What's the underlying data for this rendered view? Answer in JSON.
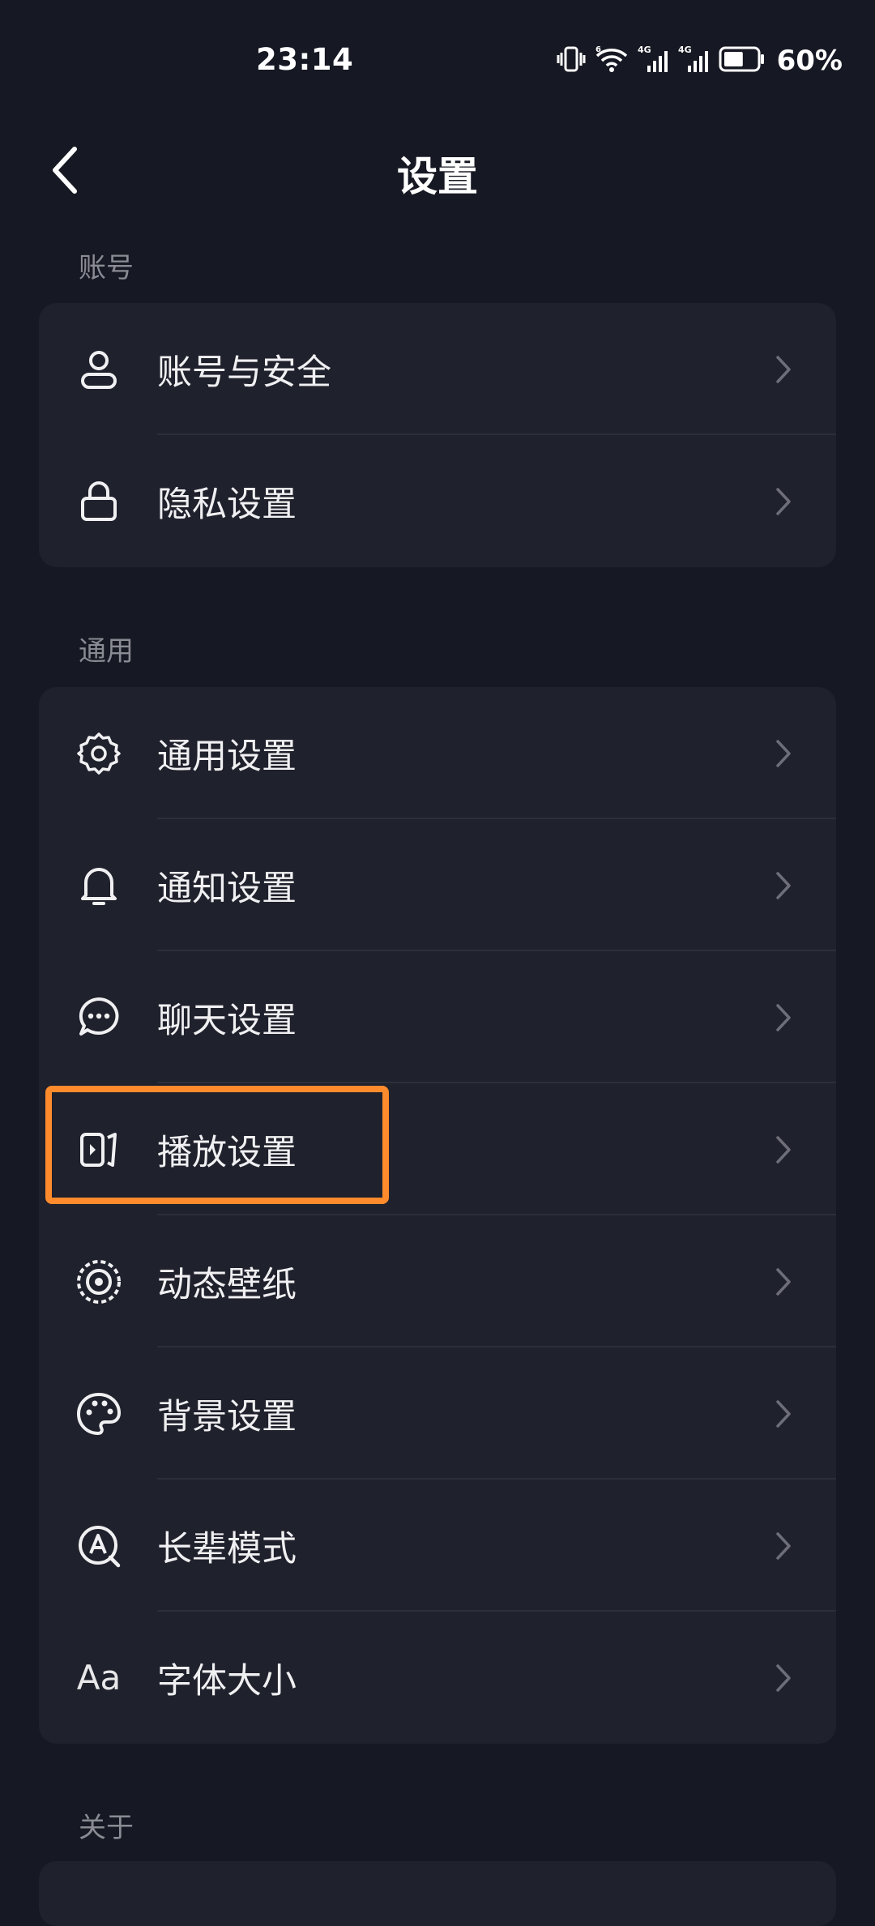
{
  "status_bar": {
    "time": "23:14",
    "battery_percent": "60%",
    "battery_level": 0.6,
    "network_labels": [
      "4G",
      "4G"
    ],
    "wifi_label": "6"
  },
  "header": {
    "title": "设置"
  },
  "sections": [
    {
      "label": "账号",
      "items": [
        {
          "label": "账号与安全",
          "icon": "user-icon"
        },
        {
          "label": "隐私设置",
          "icon": "lock-icon"
        }
      ]
    },
    {
      "label": "通用",
      "items": [
        {
          "label": "通用设置",
          "icon": "gear-icon"
        },
        {
          "label": "通知设置",
          "icon": "bell-icon"
        },
        {
          "label": "聊天设置",
          "icon": "chat-bubble-icon"
        },
        {
          "label": "播放设置",
          "icon": "play-settings-icon"
        },
        {
          "label": "动态壁纸",
          "icon": "live-wallpaper-icon"
        },
        {
          "label": "背景设置",
          "icon": "palette-icon"
        },
        {
          "label": "长辈模式",
          "icon": "elder-mode-icon"
        },
        {
          "label": "字体大小",
          "icon": "font-size-icon",
          "icon_text": "Aa"
        }
      ]
    },
    {
      "label": "关于",
      "items": []
    }
  ],
  "colors": {
    "background": "#161823",
    "card": "#1f212c",
    "highlight": "#ff8b2c",
    "section_label": "#8a8b93"
  }
}
